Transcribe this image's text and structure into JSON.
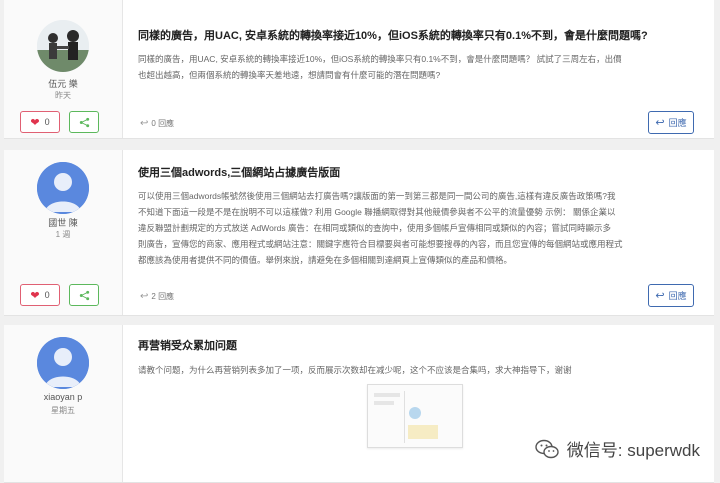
{
  "posts": [
    {
      "author": {
        "name": "伍元 樂",
        "meta": "昨天",
        "avatar": "photo-avatar"
      },
      "title": "同樣的廣告，用UAC, 安卓系統的轉換率接近10%，但iOS系統的轉換率只有0.1%不到，會是什麼問題嗎?",
      "body": [
        "同樣的廣告，用UAC, 安卓系統的轉換率接近10%，但iOS系統的轉換率只有0.1%不到，會是什麼問題嗎？ 試試了三周左右，出價",
        "也超出越高，但兩個系統的轉換率天差地遠，想請問會有什麼可能的潛在問題嗎?"
      ],
      "likes": "0",
      "reply_count": "0 回應",
      "reply_label": "回應"
    },
    {
      "author": {
        "name": "國世 陳",
        "meta": "1 週",
        "avatar": "user-avatar"
      },
      "title": "使用三個adwords,三個網站占據廣告版面",
      "body": [
        "可以使用三個adwords帳號然後使用三個網站去打廣告嗎?讓版面的第一到第三都是同一間公司的廣告,這樣有違反廣告政策嗎?我",
        "不知道下面這一段是不是在說明不可以這樣做? 利用 Google 聯播網取得對其他競價參與者不公平的流量優勢 示例： 關係企業以",
        "違反聯盟計劃規定的方式放送 AdWords 廣告：在相同或類似的查詢中，使用多個帳戶宣傳相同或類似的內容；嘗試同時顯示多",
        "則廣告，宣傳您的商家、應用程式或網站注意：關鍵字應符合目標要與者可能想要搜尋的內容，而且您宣傳的每個網站或應用程式",
        "都應該為使用者提供不同的價值。舉例來說，請避免在多個相關到達網頁上宣傳類似的產品和價格。"
      ],
      "likes": "0",
      "reply_count": "2 回應",
      "reply_label": "回應"
    },
    {
      "author": {
        "name": "xiaoyan p",
        "meta": "星期五",
        "avatar": "user-avatar"
      },
      "title": "再营销受众累加问题",
      "body": [
        "请教个问题，为什么再营销列表多加了一项，反而展示次数却在减少呢，这个不应该是合集吗，求大神指导下，谢谢"
      ]
    }
  ],
  "watermark": {
    "text": "微信号: superwdk",
    "icon": "wechat-icon"
  },
  "colors": {
    "like_border": "#e06073",
    "share_border": "#5cb85c",
    "reply_accent": "#3f6ab0",
    "avatar_blue": "#5a88de"
  }
}
